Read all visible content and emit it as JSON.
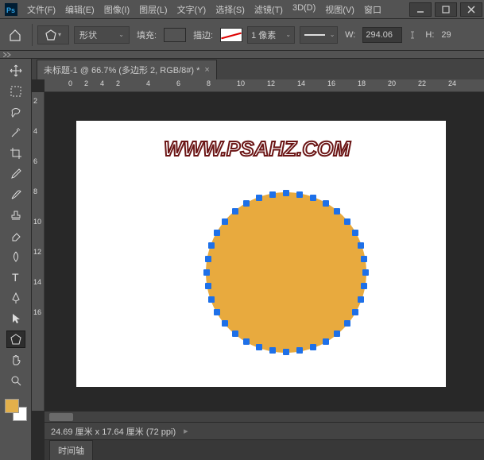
{
  "menu": {
    "file": "文件(F)",
    "edit": "编辑(E)",
    "image": "图像(I)",
    "layer": "图层(L)",
    "type": "文字(Y)",
    "select": "选择(S)",
    "filter": "滤镜(T)",
    "threed": "3D(D)",
    "view": "视图(V)",
    "window": "窗口"
  },
  "options": {
    "shape_mode": "形状",
    "fill_label": "填充:",
    "fill_color": "#e8aa3e",
    "stroke_label": "描边:",
    "stroke_width": "1 像素",
    "w_label": "W:",
    "w_value": "294.06",
    "h_label": "H:",
    "h_value": "29"
  },
  "doc": {
    "tab_title": "未标题-1 @ 66.7% (多边形 2, RGB/8#) *",
    "watermark": "WWW.PSAHZ.COM",
    "shape_fill": "#e8aa3e"
  },
  "ruler_h": [
    "2",
    "4",
    "6",
    "8",
    "10",
    "12",
    "14",
    "16",
    "18",
    "20",
    "22",
    "24"
  ],
  "ruler_v": [
    "2",
    "4",
    "6",
    "8",
    "10",
    "12",
    "14",
    "16"
  ],
  "ruler_h_origin": [
    "0",
    "2",
    "4"
  ],
  "status": {
    "dims": "24.69 厘米 x 17.64 厘米 (72 ppi)"
  },
  "panel": {
    "timeline": "时间轴"
  },
  "colors": {
    "fg": "#e3b04b"
  }
}
